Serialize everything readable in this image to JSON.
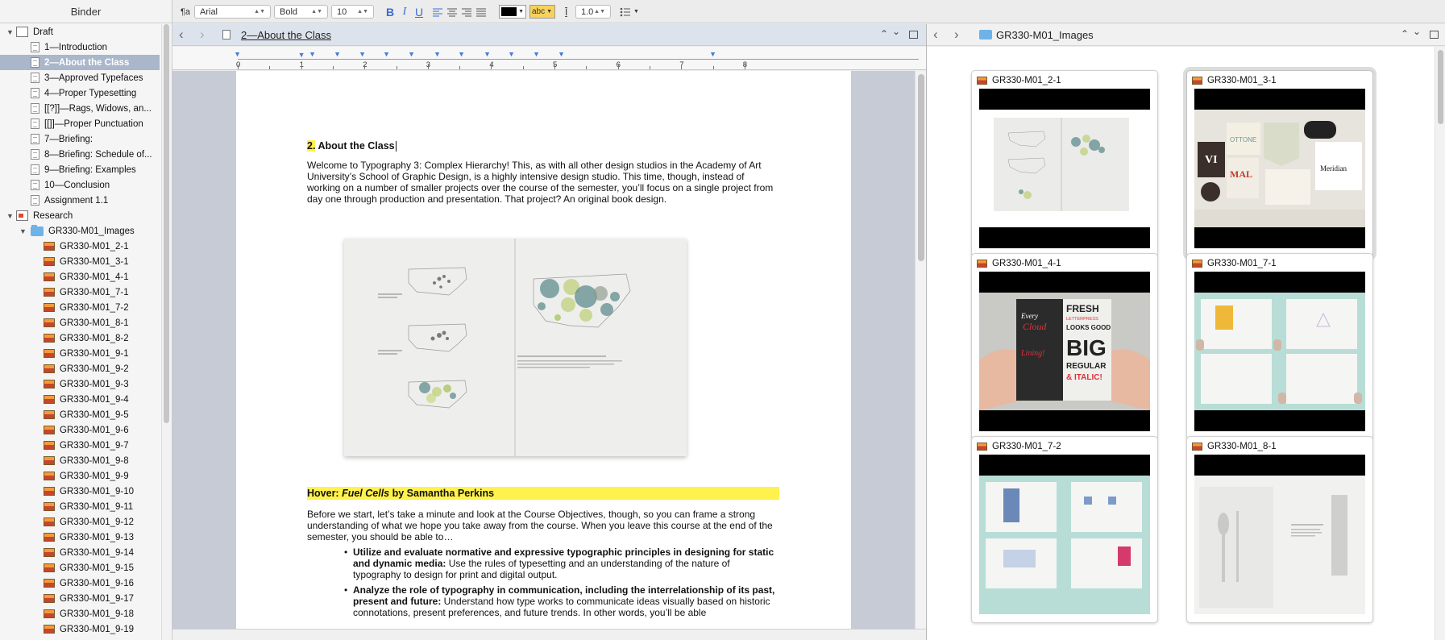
{
  "binder": {
    "header": "Binder",
    "items": [
      {
        "label": "Draft",
        "icon": "draft-icon",
        "level": 0,
        "disclosure": "▼"
      },
      {
        "label": "1—Introduction",
        "icon": "document-icon",
        "level": 1
      },
      {
        "label": "2—About the Class",
        "icon": "document-icon",
        "level": 1,
        "selected": true
      },
      {
        "label": "3—Approved Typefaces",
        "icon": "document-icon",
        "level": 1
      },
      {
        "label": "4—Proper Typesetting",
        "icon": "document-icon",
        "level": 1
      },
      {
        "label": "[[?]]—Rags, Widows, an...",
        "icon": "document-icon",
        "level": 1
      },
      {
        "label": "[[]]—Proper Punctuation",
        "icon": "document-icon",
        "level": 1
      },
      {
        "label": "7—Briefing:",
        "icon": "document-icon",
        "level": 1
      },
      {
        "label": "8—Briefing: Schedule of...",
        "icon": "document-icon",
        "level": 1
      },
      {
        "label": "9—Briefing: Examples",
        "icon": "document-icon",
        "level": 1
      },
      {
        "label": "10—Conclusion",
        "icon": "document-icon",
        "level": 1
      },
      {
        "label": "Assignment 1.1",
        "icon": "document-icon",
        "level": 1
      },
      {
        "label": "Research",
        "icon": "research-icon",
        "level": 0,
        "disclosure": "▼"
      },
      {
        "label": "GR330-M01_Images",
        "icon": "folder-icon",
        "level": 1,
        "disclosure": "▼"
      },
      {
        "label": "GR330-M01_2-1",
        "icon": "image-icon",
        "level": 2
      },
      {
        "label": "GR330-M01_3-1",
        "icon": "image-icon",
        "level": 2
      },
      {
        "label": "GR330-M01_4-1",
        "icon": "image-icon",
        "level": 2
      },
      {
        "label": "GR330-M01_7-1",
        "icon": "image-icon",
        "level": 2
      },
      {
        "label": "GR330-M01_7-2",
        "icon": "image-icon",
        "level": 2
      },
      {
        "label": "GR330-M01_8-1",
        "icon": "image-icon",
        "level": 2
      },
      {
        "label": "GR330-M01_8-2",
        "icon": "image-icon",
        "level": 2
      },
      {
        "label": "GR330-M01_9-1",
        "icon": "image-icon",
        "level": 2
      },
      {
        "label": "GR330-M01_9-2",
        "icon": "image-icon",
        "level": 2
      },
      {
        "label": "GR330-M01_9-3",
        "icon": "image-icon",
        "level": 2
      },
      {
        "label": "GR330-M01_9-4",
        "icon": "image-icon",
        "level": 2
      },
      {
        "label": "GR330-M01_9-5",
        "icon": "image-icon",
        "level": 2
      },
      {
        "label": "GR330-M01_9-6",
        "icon": "image-icon",
        "level": 2
      },
      {
        "label": "GR330-M01_9-7",
        "icon": "image-icon",
        "level": 2
      },
      {
        "label": "GR330-M01_9-8",
        "icon": "image-icon",
        "level": 2
      },
      {
        "label": "GR330-M01_9-9",
        "icon": "image-icon",
        "level": 2
      },
      {
        "label": "GR330-M01_9-10",
        "icon": "image-icon",
        "level": 2
      },
      {
        "label": "GR330-M01_9-11",
        "icon": "image-icon",
        "level": 2
      },
      {
        "label": "GR330-M01_9-12",
        "icon": "image-icon",
        "level": 2
      },
      {
        "label": "GR330-M01_9-13",
        "icon": "image-icon",
        "level": 2
      },
      {
        "label": "GR330-M01_9-14",
        "icon": "image-icon",
        "level": 2
      },
      {
        "label": "GR330-M01_9-15",
        "icon": "image-icon",
        "level": 2
      },
      {
        "label": "GR330-M01_9-16",
        "icon": "image-icon",
        "level": 2
      },
      {
        "label": "GR330-M01_9-17",
        "icon": "image-icon",
        "level": 2
      },
      {
        "label": "GR330-M01_9-18",
        "icon": "image-icon",
        "level": 2
      },
      {
        "label": "GR330-M01_9-19",
        "icon": "image-icon",
        "level": 2
      }
    ]
  },
  "toolbar": {
    "paragraph_style": "¶a",
    "font_family": "Arial",
    "font_style": "Bold",
    "font_size": "10",
    "bold": "B",
    "italic": "I",
    "underline": "U",
    "highlight": "abc",
    "line_spacing": "1.0",
    "text_color": "#000000",
    "highlight_color": "#f7d25a"
  },
  "editor": {
    "header_title": "2—About the Class",
    "ruler_numbers": [
      "0",
      "1",
      "2",
      "3",
      "4",
      "5",
      "6",
      "7",
      "8"
    ],
    "doc": {
      "title_num": "2.",
      "title_text": " About the Class",
      "para1": "Welcome to Typography 3: Complex Hierarchy! This, as with all other design studios in the Academy of Art University’s School of Graphic Design, is a highly intensive design studio. This time, though, instead of working on a number of smaller projects over the course of the semester, you’ll focus on a single project from day one through production and presentation. That project? An original book design.",
      "hover_label": "Hover: ",
      "hover_title": "Fuel Cells",
      "hover_by": " by Samantha Perkins",
      "para2": "Before we start, let’s take a minute and look at the Course Objectives, though, so you can frame a strong understanding of what we hope you take away from the course. When you leave this course at the end of the semester, you should be able to…",
      "bullets": [
        {
          "bold": "Utilize and evaluate normative and expressive typographic principles in designing for static and dynamic media:",
          "text": " Use the rules of typesetting and an understanding of the nature of typography to design for print and digital output."
        },
        {
          "bold": "Analyze the role of typography in communication, including the interrelationship of its past, present and future:",
          "text": " Understand how type works to communicate ideas visually based on historic connotations, present preferences, and future trends. In other words, you’ll be able"
        }
      ]
    }
  },
  "right_pane": {
    "title": "GR330-M01_Images",
    "cards": [
      {
        "title": "GR330-M01_2-1",
        "selected": false
      },
      {
        "title": "GR330-M01_3-1",
        "selected": true
      },
      {
        "title": "GR330-M01_4-1",
        "selected": false
      },
      {
        "title": "GR330-M01_7-1",
        "selected": false
      },
      {
        "title": "GR330-M01_7-2",
        "selected": false
      },
      {
        "title": "GR330-M01_8-1",
        "selected": false
      }
    ],
    "thumb_4_1": {
      "l1": "FRESH",
      "l2": "LETTERPRESS",
      "l3": "LOOKS GOOD",
      "l4": "BIG",
      "l5": "REGULAR",
      "l6": "& ITALIC!",
      "l7": "Every",
      "l8": "Cloud",
      "l9": "Lining!"
    },
    "thumb_3_1": {
      "a": "VI",
      "b": "OTTONE",
      "c": "MAL",
      "d": "Meridian"
    }
  }
}
